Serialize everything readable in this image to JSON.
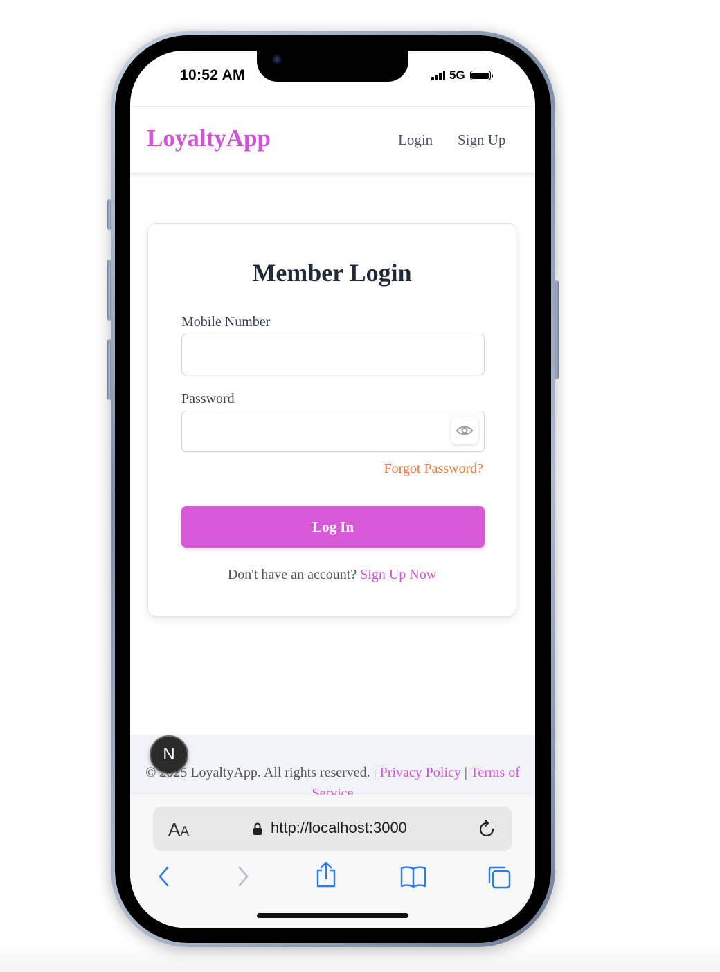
{
  "status_bar": {
    "time": "10:52 AM",
    "network": "5G"
  },
  "header": {
    "brand": "LoyaltyApp",
    "nav": {
      "login": "Login",
      "signup": "Sign Up"
    }
  },
  "login_card": {
    "title": "Member Login",
    "mobile_label": "Mobile Number",
    "mobile_value": "",
    "password_label": "Password",
    "password_value": "",
    "forgot_password": "Forgot Password?",
    "submit_label": "Log In",
    "no_account_text": "Don't have an account?",
    "signup_link": "Sign Up Now"
  },
  "footer": {
    "copyright": "© 2025 LoyaltyApp. All rights reserved. | ",
    "privacy": "Privacy Policy",
    "separator": " | ",
    "terms": "Terms of Service"
  },
  "dev_badge": {
    "letter": "N"
  },
  "browser": {
    "aa_large": "A",
    "aa_small": "A",
    "url": "http://localhost:3000",
    "toolbar_icons": [
      "back-icon",
      "forward-icon",
      "share-icon",
      "bookmarks-icon",
      "tabs-icon"
    ]
  },
  "colors": {
    "accent": "#d054d4",
    "button": "#d65ad8",
    "forgot": "#e47a3c",
    "title": "#1f2937"
  }
}
